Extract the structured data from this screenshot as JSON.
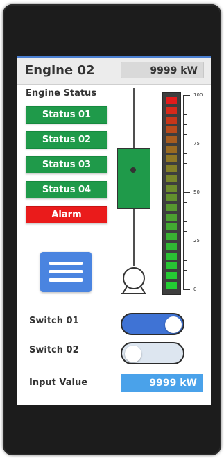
{
  "header": {
    "title": "Engine 02",
    "power_display": "9999 kW"
  },
  "engine_status": {
    "label": "Engine Status",
    "buttons": [
      "Status 01",
      "Status 02",
      "Status 03",
      "Status 04"
    ],
    "alarm_label": "Alarm",
    "status_color": "#1f9a4a",
    "alarm_color": "#ea1b1b"
  },
  "menu": {
    "icon": "hamburger-menu-icon"
  },
  "valve": {
    "icon": "valve-icon"
  },
  "pump": {
    "icon": "pump-icon"
  },
  "level_bar": {
    "level_fraction": 1.0,
    "scale_ticks": [
      "100",
      "75",
      "50",
      "25",
      "0"
    ]
  },
  "switches": [
    {
      "label": "Switch 01",
      "state": "on"
    },
    {
      "label": "Switch 02",
      "state": "off"
    }
  ],
  "input": {
    "label": "Input Value",
    "value": "9999 kW"
  },
  "colors": {
    "accent": "#4a84e0",
    "toggle_on": "#3f73d5",
    "input_bg": "#4aa2ea"
  }
}
